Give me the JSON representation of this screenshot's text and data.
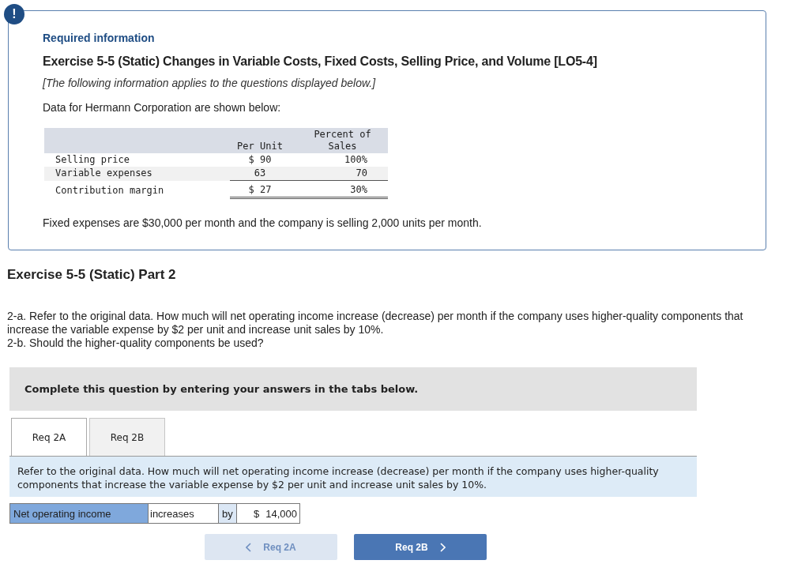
{
  "alert_badge": "!",
  "info_box": {
    "heading": "Required information",
    "title": "Exercise 5-5 (Static) Changes in Variable Costs, Fixed Costs, Selling Price, and Volume [LO5-4]",
    "note": "[The following information applies to the questions displayed below.]",
    "intro": "Data for Hermann Corporation are shown below:",
    "table": {
      "columns": [
        "Per Unit",
        "Percent of Sales"
      ],
      "rows": [
        {
          "label": "Selling price",
          "values": [
            "$ 90",
            "100%"
          ],
          "kind": "item"
        },
        {
          "label": "Variable expenses",
          "values": [
            "63",
            "70"
          ],
          "kind": "subtotal"
        },
        {
          "label": "Contribution margin",
          "values": [
            "$ 27",
            "30%"
          ],
          "kind": "total"
        }
      ]
    },
    "footer": "Fixed expenses are $30,000 per month and the company is selling 2,000 units per month."
  },
  "part_title": "Exercise 5-5 (Static) Part 2",
  "questions": [
    "2-a. Refer to the original data. How much will net operating income increase (decrease) per month if the company uses higher-quality components that increase the variable expense by $2 per unit and increase unit sales by 10%.",
    "2-b. Should the higher-quality components be used?"
  ],
  "instruction": "Complete this question by entering your answers in the tabs below.",
  "tabs": [
    {
      "label": "Req 2A",
      "selected": true
    },
    {
      "label": "Req 2B",
      "selected": false
    }
  ],
  "tab_prompt": "Refer to the original data. How much will net operating income increase (decrease) per month if the company uses higher-quality components that increase the variable expense by $2 per unit and increase unit sales by 10%.",
  "answer": {
    "label": "Net operating income",
    "direction": "increases",
    "connector": "by",
    "currency": "$",
    "amount": "14,000"
  },
  "nav": [
    {
      "kind": "prev",
      "label": "Req 2A",
      "disabled": true
    },
    {
      "kind": "next",
      "label": "Req 2B",
      "disabled": false
    }
  ]
}
